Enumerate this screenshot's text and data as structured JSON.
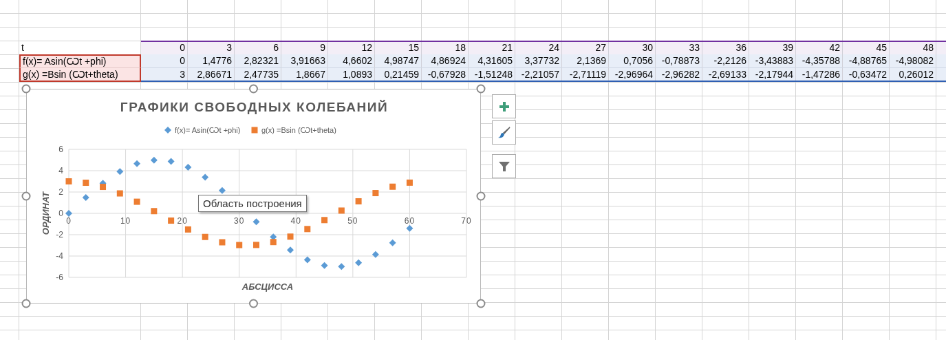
{
  "sheet": {
    "rows": [
      {
        "kind": "x",
        "label": "t",
        "values": [
          "0",
          "3",
          "6",
          "9",
          "12",
          "15",
          "18",
          "21",
          "24",
          "27",
          "30",
          "33",
          "36",
          "39",
          "42",
          "45",
          "48"
        ]
      },
      {
        "kind": "y",
        "label": "f(x)= Asin(Ѡt +phi)",
        "values": [
          "0",
          "1,4776",
          "2,82321",
          "3,91663",
          "4,6602",
          "4,98747",
          "4,86924",
          "4,31605",
          "3,37732",
          "2,1369",
          "0,7056",
          "-0,78873",
          "-2,2126",
          "-3,43883",
          "-4,35788",
          "-4,88765",
          "-4,98082"
        ]
      },
      {
        "kind": "y",
        "label": "g(x) =Bsin (Ѡt+theta)",
        "values": [
          "3",
          "2,86671",
          "2,47735",
          "1,8667",
          "1,0893",
          "0,21459",
          "-0,67928",
          "-1,51248",
          "-2,21057",
          "-2,71119",
          "-2,96964",
          "-2,96282",
          "-2,69133",
          "-2,17944",
          "-1,47286",
          "-0,63472",
          "0,26012"
        ]
      }
    ]
  },
  "chart": {
    "tooltip": "Область построения",
    "chart_data": {
      "type": "scatter",
      "title": "ГРАФИКИ СВОБОДНЫХ КОЛЕБАНИЙ",
      "xlabel": "АБСЦИССА",
      "ylabel": "ОРДИНАТ",
      "grid": true,
      "legend": true,
      "x": [
        0,
        3,
        6,
        9,
        12,
        15,
        18,
        21,
        24,
        27,
        30,
        33,
        36,
        39,
        42,
        45,
        48,
        51,
        54,
        57,
        60
      ],
      "series": [
        {
          "name": "f(x)= Asin(Ѡt +phi)",
          "color": "#5b9bd5",
          "values": [
            0,
            1.48,
            2.82,
            3.92,
            4.66,
            4.99,
            4.87,
            4.32,
            3.38,
            2.14,
            null,
            -0.79,
            -2.21,
            -3.44,
            -4.36,
            -4.89,
            -4.98,
            -4.63,
            -3.86,
            -2.75,
            -1.4
          ]
        },
        {
          "name": "g(x) =Bsin (Ѡt+theta)",
          "color": "#ed7d31",
          "values": [
            3,
            2.87,
            2.48,
            1.87,
            1.09,
            0.21,
            -0.68,
            -1.51,
            -2.21,
            -2.71,
            -2.97,
            -2.96,
            -2.69,
            -2.18,
            -1.47,
            -0.63,
            0.26,
            1.13,
            1.9,
            2.5,
            2.88
          ]
        }
      ],
      "xlim": [
        0,
        70
      ],
      "ylim": [
        -6,
        6
      ],
      "xticks": [
        {
          "value": 0,
          "label": "0"
        },
        {
          "value": 10,
          "label": "10"
        },
        {
          "value": 20,
          "label": "20"
        },
        {
          "value": 30,
          "label": "30"
        },
        {
          "value": 40,
          "label": "40"
        },
        {
          "value": 50,
          "label": "50"
        },
        {
          "value": 60,
          "label": "60"
        },
        {
          "value": 70,
          "label": "70"
        }
      ],
      "yticks": [
        {
          "value": -6,
          "label": "-6"
        },
        {
          "value": -4,
          "label": "-4"
        },
        {
          "value": -2,
          "label": "-2"
        },
        {
          "value": 0,
          "label": "0"
        },
        {
          "value": 2,
          "label": "2"
        },
        {
          "value": 4,
          "label": "4"
        },
        {
          "value": 6,
          "label": "6"
        }
      ]
    }
  }
}
